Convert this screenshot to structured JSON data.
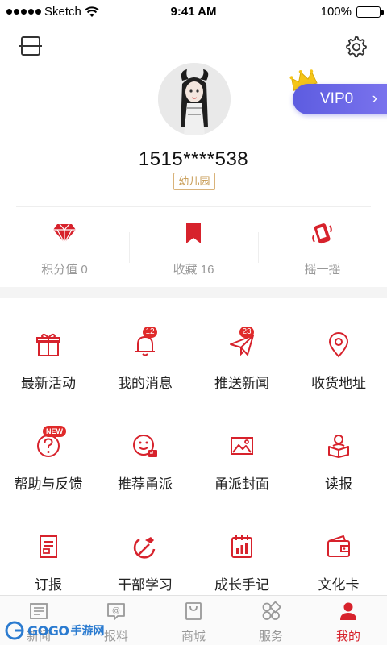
{
  "status_bar": {
    "carrier": "Sketch",
    "time": "9:41 AM",
    "battery": "100%"
  },
  "profile": {
    "phone": "1515****538",
    "level": "幼儿园"
  },
  "vip": {
    "label": "VIP0",
    "chevron": "›"
  },
  "stats": [
    {
      "label": "积分值 0",
      "icon": "diamond-icon"
    },
    {
      "label": "收藏 16",
      "icon": "bookmark-icon"
    },
    {
      "label": "摇一摇",
      "icon": "shake-phone-icon"
    }
  ],
  "grid": {
    "row1": [
      {
        "label": "最新活动",
        "icon": "gift-icon"
      },
      {
        "label": "我的消息",
        "icon": "bell-icon",
        "badge": "12"
      },
      {
        "label": "推送新闻",
        "icon": "paper-plane-icon",
        "badge": "23"
      },
      {
        "label": "收货地址",
        "icon": "location-pin-icon"
      }
    ],
    "row2": [
      {
        "label": "帮助与反馈",
        "icon": "help-icon",
        "badge": "NEW"
      },
      {
        "label": "推荐甬派",
        "icon": "recommend-icon"
      },
      {
        "label": "甬派封面",
        "icon": "image-icon"
      },
      {
        "label": "读报",
        "icon": "reader-icon"
      }
    ],
    "row3": [
      {
        "label": "订报",
        "icon": "document-icon"
      },
      {
        "label": "干部学习",
        "icon": "hammer-sickle-icon"
      },
      {
        "label": "成长手记",
        "icon": "growth-notebook-icon"
      },
      {
        "label": "文化卡",
        "icon": "wallet-icon"
      }
    ]
  },
  "tabbar": [
    {
      "label": "新闻",
      "icon": "news-icon"
    },
    {
      "label": "报料",
      "icon": "report-icon"
    },
    {
      "label": "商城",
      "icon": "shop-icon"
    },
    {
      "label": "服务",
      "icon": "services-icon"
    },
    {
      "label": "我的",
      "icon": "profile-icon",
      "active": true
    }
  ],
  "watermark": {
    "brand": "GOGO",
    "suffix": "手游网"
  },
  "colors": {
    "accent": "#d7222c",
    "vip": "#6a66e6",
    "badge_border": "#d9b37a"
  }
}
